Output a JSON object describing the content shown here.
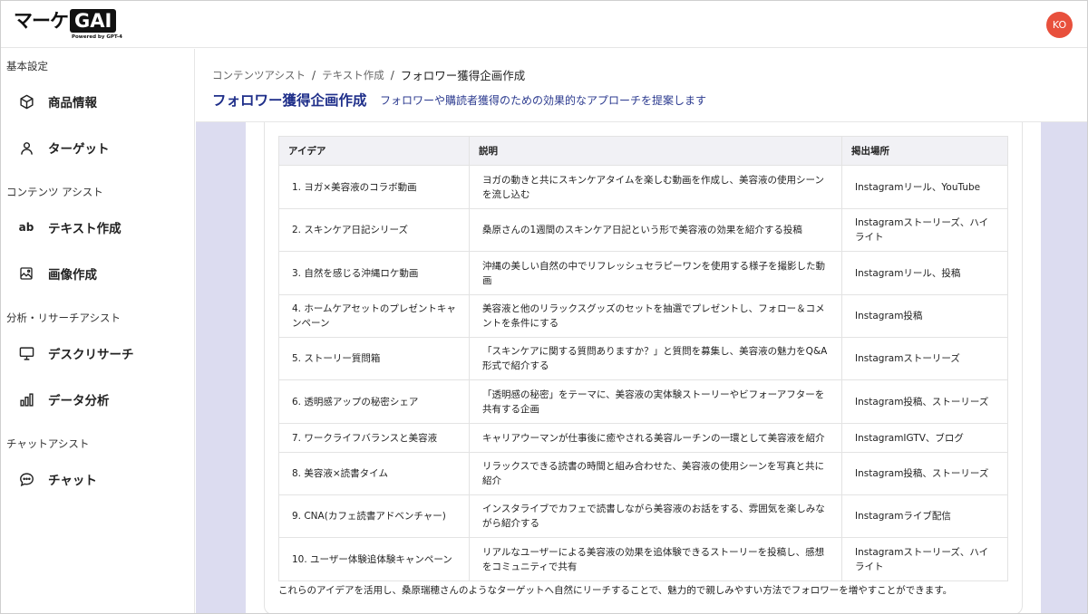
{
  "app": {
    "logo_text": "マーケ",
    "logo_badge": "GAI",
    "logo_sub": "Powered by GPT-4",
    "avatar_initials": "KO",
    "avatar_color": "#e8503c",
    "accent_color": "#1f2f8a"
  },
  "sidebar": {
    "sections": [
      {
        "label": "基本設定"
      },
      {
        "label": "コンテンツ アシスト"
      },
      {
        "label": "分析・リサーチアシスト"
      },
      {
        "label": "チャットアシスト"
      }
    ],
    "items": [
      {
        "label": "商品情報",
        "icon": "cube-icon"
      },
      {
        "label": "ターゲット",
        "icon": "person-icon"
      },
      {
        "label": "テキスト作成",
        "icon": "ab-text-icon",
        "icon_text": "ab"
      },
      {
        "label": "画像作成",
        "icon": "image-icon"
      },
      {
        "label": "デスクリサーチ",
        "icon": "monitor-icon"
      },
      {
        "label": "データ分析",
        "icon": "bar-chart-icon"
      },
      {
        "label": "チャット",
        "icon": "chat-bubble-icon"
      }
    ]
  },
  "header": {
    "breadcrumb": [
      "コンテンツアシスト",
      "テキスト作成",
      "フォロワー獲得企画作成"
    ],
    "separator": "/",
    "title": "フォロワー獲得企画作成",
    "description": "フォロワーや購読者獲得のための効果的なアプローチを提案します"
  },
  "table": {
    "headers": [
      "アイデア",
      "説明",
      "掲出場所"
    ],
    "rows": [
      [
        "1. ヨガ×美容液のコラボ動画",
        "ヨガの動きと共にスキンケアタイムを楽しむ動画を作成し、美容液の使用シーンを流し込む",
        "Instagramリール、YouTube"
      ],
      [
        "2. スキンケア日記シリーズ",
        "桑原さんの1週間のスキンケア日記という形で美容液の効果を紹介する投稿",
        "Instagramストーリーズ、ハイライト"
      ],
      [
        "3. 自然を感じる沖縄ロケ動画",
        "沖縄の美しい自然の中でリフレッシュセラピーワンを使用する様子を撮影した動画",
        "Instagramリール、投稿"
      ],
      [
        "4. ホームケアセットのプレゼントキャンペーン",
        "美容液と他のリラックスグッズのセットを抽選でプレゼントし、フォロー＆コメントを条件にする",
        "Instagram投稿"
      ],
      [
        "5. ストーリー質問箱",
        "「スキンケアに関する質問ありますか？」と質問を募集し、美容液の魅力をQ&A形式で紹介する",
        "Instagramストーリーズ"
      ],
      [
        "6. 透明感アップの秘密シェア",
        "「透明感の秘密」をテーマに、美容液の実体験ストーリーやビフォーアフターを共有する企画",
        "Instagram投稿、ストーリーズ"
      ],
      [
        "7. ワークライフバランスと美容液",
        "キャリアウーマンが仕事後に癒やされる美容ルーチンの一環として美容液を紹介",
        "InstagramIGTV、ブログ"
      ],
      [
        "8. 美容液×読書タイム",
        "リラックスできる読書の時間と組み合わせた、美容液の使用シーンを写真と共に紹介",
        "Instagram投稿、ストーリーズ"
      ],
      [
        "9. CNA(カフェ読書アドベンチャー)",
        "インスタライブでカフェで読書しながら美容液のお話をする、雰囲気を楽しみながら紹介する",
        "Instagramライブ配信"
      ],
      [
        "10. ユーザー体験追体験キャンペーン",
        "リアルなユーザーによる美容液の効果を追体験できるストーリーを投稿し、感想をコミュニティで共有",
        "Instagramストーリーズ、ハイライト"
      ]
    ]
  },
  "footer_note": "これらのアイデアを活用し、桑原瑞穂さんのようなターゲットへ自然にリーチすることで、魅力的で親しみやすい方法でフォロワーを増やすことができます。"
}
